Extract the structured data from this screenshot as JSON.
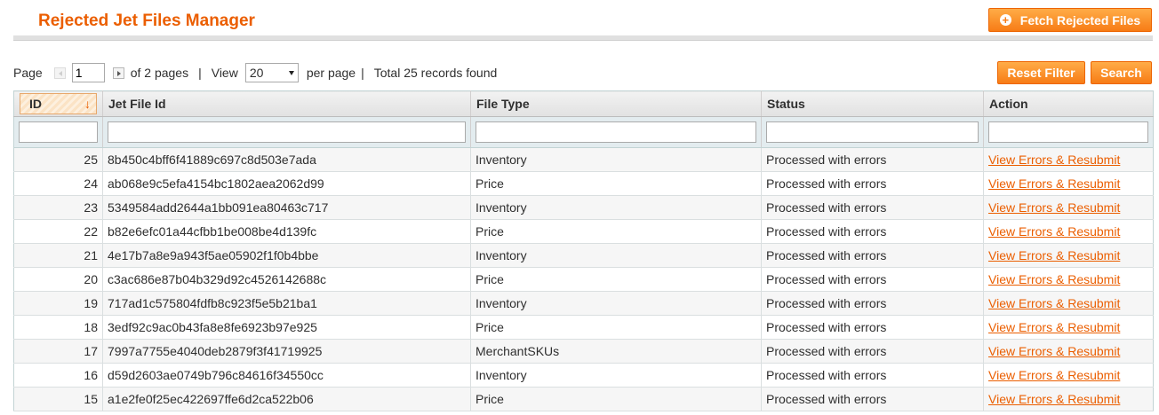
{
  "header": {
    "title": "Rejected Jet Files Manager",
    "fetch_button": "Fetch Rejected Files",
    "fetch_icon": "plus-circle-icon"
  },
  "pager": {
    "page_label": "Page",
    "current_page": "1",
    "of_pages": "of 2 pages",
    "sep1": "|",
    "view_label": "View",
    "per_page_value": "20",
    "per_page_label": "per page",
    "sep2": "|",
    "total": "Total 25 records found"
  },
  "actions": {
    "reset_filter": "Reset Filter",
    "search": "Search"
  },
  "grid": {
    "columns": [
      "ID",
      "Jet File Id",
      "File Type",
      "Status",
      "Action"
    ],
    "sort_indicator": "↓",
    "rows": [
      {
        "id": "25",
        "jet_file_id": "8b450c4bff6f41889c697c8d503e7ada",
        "file_type": "Inventory",
        "status": "Processed with errors",
        "action": "View Errors & Resubmit"
      },
      {
        "id": "24",
        "jet_file_id": "ab068e9c5efa4154bc1802aea2062d99",
        "file_type": "Price",
        "status": "Processed with errors",
        "action": "View Errors & Resubmit"
      },
      {
        "id": "23",
        "jet_file_id": "5349584add2644a1bb091ea80463c717",
        "file_type": "Inventory",
        "status": "Processed with errors",
        "action": "View Errors & Resubmit"
      },
      {
        "id": "22",
        "jet_file_id": "b82e6efc01a44cfbb1be008be4d139fc",
        "file_type": "Price",
        "status": "Processed with errors",
        "action": "View Errors & Resubmit"
      },
      {
        "id": "21",
        "jet_file_id": "4e17b7a8e9a943f5ae05902f1f0b4bbe",
        "file_type": "Inventory",
        "status": "Processed with errors",
        "action": "View Errors & Resubmit"
      },
      {
        "id": "20",
        "jet_file_id": "c3ac686e87b04b329d92c4526142688c",
        "file_type": "Price",
        "status": "Processed with errors",
        "action": "View Errors & Resubmit"
      },
      {
        "id": "19",
        "jet_file_id": "717ad1c575804fdfb8c923f5e5b21ba1",
        "file_type": "Inventory",
        "status": "Processed with errors",
        "action": "View Errors & Resubmit"
      },
      {
        "id": "18",
        "jet_file_id": "3edf92c9ac0b43fa8e8fe6923b97e925",
        "file_type": "Price",
        "status": "Processed with errors",
        "action": "View Errors & Resubmit"
      },
      {
        "id": "17",
        "jet_file_id": "7997a7755e4040deb2879f3f41719925",
        "file_type": "MerchantSKUs",
        "status": "Processed with errors",
        "action": "View Errors & Resubmit"
      },
      {
        "id": "16",
        "jet_file_id": "d59d2603ae0749b796c84616f34550cc",
        "file_type": "Inventory",
        "status": "Processed with errors",
        "action": "View Errors & Resubmit"
      },
      {
        "id": "15",
        "jet_file_id": "a1e2fe0f25ec422697ffe6d2ca522b06",
        "file_type": "Price",
        "status": "Processed with errors",
        "action": "View Errors & Resubmit"
      }
    ]
  },
  "colors": {
    "accent": "#eb5e00",
    "button_top": "#ffac47",
    "button_bottom": "#f77c16",
    "filter_row": "#e3ecef"
  }
}
